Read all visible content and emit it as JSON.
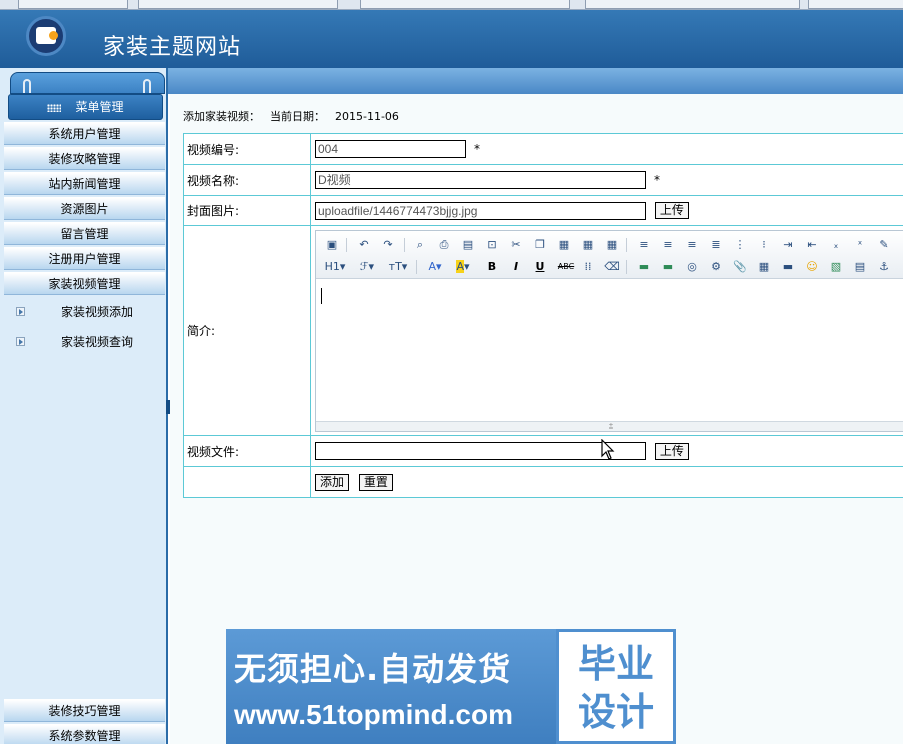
{
  "site": {
    "title": "家装主题网站"
  },
  "sidebar": {
    "header_label": "菜单管理",
    "items": [
      {
        "label": "系统用户管理"
      },
      {
        "label": "装修攻略管理"
      },
      {
        "label": "站内新闻管理"
      },
      {
        "label": "资源图片"
      },
      {
        "label": "留言管理"
      },
      {
        "label": "注册用户管理"
      },
      {
        "label": "家装视频管理"
      }
    ],
    "sub_items": [
      {
        "label": "家装视频添加"
      },
      {
        "label": "家装视频查询"
      }
    ],
    "bottom_items": [
      {
        "label": "装修技巧管理"
      },
      {
        "label": "系统参数管理"
      }
    ]
  },
  "main": {
    "heading": "添加家装视频：",
    "date_label": "当前日期：",
    "date_value": "2015-11-06",
    "form": {
      "video_no_label": "视频编号:",
      "video_no_value": "004",
      "required_mark": "*",
      "video_name_label": "视频名称:",
      "video_name_value": "D视频",
      "cover_label": "封面图片:",
      "cover_value": "uploadfile/1446774473bjjg.jpg",
      "upload_label": "上传",
      "intro_label": "简介:",
      "file_label": "视频文件:",
      "file_value": "",
      "submit_label": "添加",
      "reset_label": "重置"
    }
  },
  "editor": {
    "toolbar_labels": [
      "H1",
      "A",
      "A",
      "B",
      "I",
      "U",
      "ABC"
    ],
    "content": ""
  },
  "watermark": {
    "slogan": "无须担心.自动发货",
    "url": "www.51topmind.com",
    "badge_line1": "毕业",
    "badge_line2": "设计"
  },
  "colors": {
    "header": "#1f5c99",
    "sidebar_bg": "#dcecf9",
    "table_border": "#5cc9d6",
    "banner": "#4f8fcf"
  }
}
